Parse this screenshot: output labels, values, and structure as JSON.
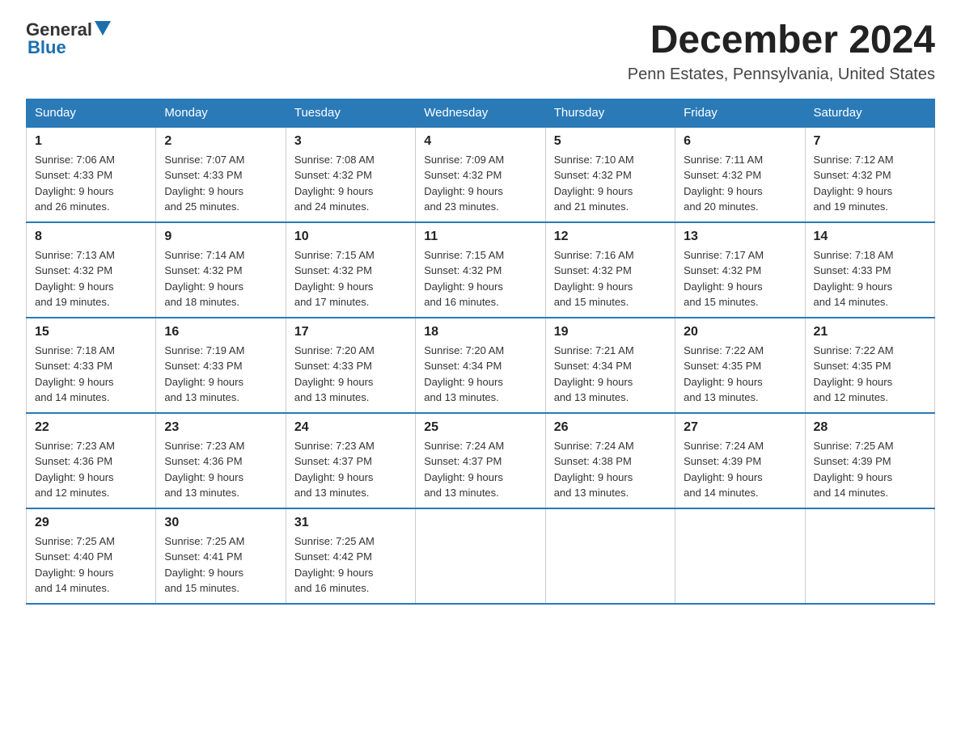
{
  "header": {
    "logo_general": "General",
    "logo_blue": "Blue",
    "title": "December 2024",
    "subtitle": "Penn Estates, Pennsylvania, United States"
  },
  "days_of_week": [
    "Sunday",
    "Monday",
    "Tuesday",
    "Wednesday",
    "Thursday",
    "Friday",
    "Saturday"
  ],
  "weeks": [
    [
      {
        "day": "1",
        "sunrise": "7:06 AM",
        "sunset": "4:33 PM",
        "daylight": "9 hours and 26 minutes."
      },
      {
        "day": "2",
        "sunrise": "7:07 AM",
        "sunset": "4:33 PM",
        "daylight": "9 hours and 25 minutes."
      },
      {
        "day": "3",
        "sunrise": "7:08 AM",
        "sunset": "4:32 PM",
        "daylight": "9 hours and 24 minutes."
      },
      {
        "day": "4",
        "sunrise": "7:09 AM",
        "sunset": "4:32 PM",
        "daylight": "9 hours and 23 minutes."
      },
      {
        "day": "5",
        "sunrise": "7:10 AM",
        "sunset": "4:32 PM",
        "daylight": "9 hours and 21 minutes."
      },
      {
        "day": "6",
        "sunrise": "7:11 AM",
        "sunset": "4:32 PM",
        "daylight": "9 hours and 20 minutes."
      },
      {
        "day": "7",
        "sunrise": "7:12 AM",
        "sunset": "4:32 PM",
        "daylight": "9 hours and 19 minutes."
      }
    ],
    [
      {
        "day": "8",
        "sunrise": "7:13 AM",
        "sunset": "4:32 PM",
        "daylight": "9 hours and 19 minutes."
      },
      {
        "day": "9",
        "sunrise": "7:14 AM",
        "sunset": "4:32 PM",
        "daylight": "9 hours and 18 minutes."
      },
      {
        "day": "10",
        "sunrise": "7:15 AM",
        "sunset": "4:32 PM",
        "daylight": "9 hours and 17 minutes."
      },
      {
        "day": "11",
        "sunrise": "7:15 AM",
        "sunset": "4:32 PM",
        "daylight": "9 hours and 16 minutes."
      },
      {
        "day": "12",
        "sunrise": "7:16 AM",
        "sunset": "4:32 PM",
        "daylight": "9 hours and 15 minutes."
      },
      {
        "day": "13",
        "sunrise": "7:17 AM",
        "sunset": "4:32 PM",
        "daylight": "9 hours and 15 minutes."
      },
      {
        "day": "14",
        "sunrise": "7:18 AM",
        "sunset": "4:33 PM",
        "daylight": "9 hours and 14 minutes."
      }
    ],
    [
      {
        "day": "15",
        "sunrise": "7:18 AM",
        "sunset": "4:33 PM",
        "daylight": "9 hours and 14 minutes."
      },
      {
        "day": "16",
        "sunrise": "7:19 AM",
        "sunset": "4:33 PM",
        "daylight": "9 hours and 13 minutes."
      },
      {
        "day": "17",
        "sunrise": "7:20 AM",
        "sunset": "4:33 PM",
        "daylight": "9 hours and 13 minutes."
      },
      {
        "day": "18",
        "sunrise": "7:20 AM",
        "sunset": "4:34 PM",
        "daylight": "9 hours and 13 minutes."
      },
      {
        "day": "19",
        "sunrise": "7:21 AM",
        "sunset": "4:34 PM",
        "daylight": "9 hours and 13 minutes."
      },
      {
        "day": "20",
        "sunrise": "7:22 AM",
        "sunset": "4:35 PM",
        "daylight": "9 hours and 13 minutes."
      },
      {
        "day": "21",
        "sunrise": "7:22 AM",
        "sunset": "4:35 PM",
        "daylight": "9 hours and 12 minutes."
      }
    ],
    [
      {
        "day": "22",
        "sunrise": "7:23 AM",
        "sunset": "4:36 PM",
        "daylight": "9 hours and 12 minutes."
      },
      {
        "day": "23",
        "sunrise": "7:23 AM",
        "sunset": "4:36 PM",
        "daylight": "9 hours and 13 minutes."
      },
      {
        "day": "24",
        "sunrise": "7:23 AM",
        "sunset": "4:37 PM",
        "daylight": "9 hours and 13 minutes."
      },
      {
        "day": "25",
        "sunrise": "7:24 AM",
        "sunset": "4:37 PM",
        "daylight": "9 hours and 13 minutes."
      },
      {
        "day": "26",
        "sunrise": "7:24 AM",
        "sunset": "4:38 PM",
        "daylight": "9 hours and 13 minutes."
      },
      {
        "day": "27",
        "sunrise": "7:24 AM",
        "sunset": "4:39 PM",
        "daylight": "9 hours and 14 minutes."
      },
      {
        "day": "28",
        "sunrise": "7:25 AM",
        "sunset": "4:39 PM",
        "daylight": "9 hours and 14 minutes."
      }
    ],
    [
      {
        "day": "29",
        "sunrise": "7:25 AM",
        "sunset": "4:40 PM",
        "daylight": "9 hours and 14 minutes."
      },
      {
        "day": "30",
        "sunrise": "7:25 AM",
        "sunset": "4:41 PM",
        "daylight": "9 hours and 15 minutes."
      },
      {
        "day": "31",
        "sunrise": "7:25 AM",
        "sunset": "4:42 PM",
        "daylight": "9 hours and 16 minutes."
      },
      null,
      null,
      null,
      null
    ]
  ],
  "labels": {
    "sunrise": "Sunrise:",
    "sunset": "Sunset:",
    "daylight": "Daylight:"
  }
}
